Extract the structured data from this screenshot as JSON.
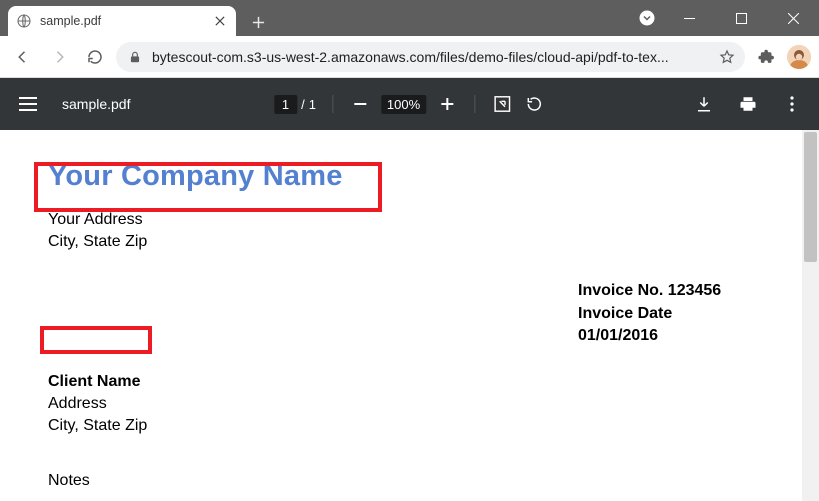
{
  "browser": {
    "tab_title": "sample.pdf",
    "url": "bytescout-com.s3-us-west-2.amazonaws.com/files/demo-files/cloud-api/pdf-to-tex..."
  },
  "pdf_toolbar": {
    "filename": "sample.pdf",
    "page_current": "1",
    "page_sep": "/",
    "page_total": "1",
    "zoom": "100%"
  },
  "document": {
    "company_name": "Your Company Name",
    "company_address_line1": "Your Address",
    "company_address_line2": "City, State Zip",
    "invoice_no_label": "Invoice No. 123456",
    "invoice_date_label": "Invoice Date 01/01/2016",
    "client_name": "Client Name",
    "client_address_line1": "Address",
    "client_address_line2": "City, State Zip",
    "notes_label": "Notes"
  }
}
